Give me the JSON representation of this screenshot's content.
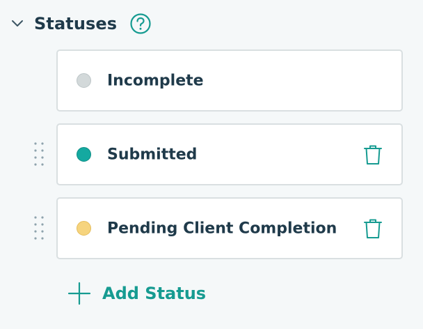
{
  "section": {
    "title": "Statuses",
    "help_icon": "help-circle-icon",
    "collapse_icon": "chevron-down-icon"
  },
  "statuses": [
    {
      "label": "Incomplete",
      "color": "#d3d9da",
      "border": "#bcc5c7",
      "deletable": false,
      "draggable": false
    },
    {
      "label": "Submitted",
      "color": "#14a9a0",
      "border": "#0f8e86",
      "deletable": true,
      "draggable": true
    },
    {
      "label": "Pending Client Completion",
      "color": "#f6d47e",
      "border": "#e5bd5c",
      "deletable": true,
      "draggable": true
    }
  ],
  "add_button": {
    "label": "Add Status",
    "icon": "plus-icon"
  },
  "colors": {
    "accent": "#169b91",
    "text": "#1f3a4a",
    "card_border": "#d9dfe1",
    "background": "#f5f8f9"
  }
}
